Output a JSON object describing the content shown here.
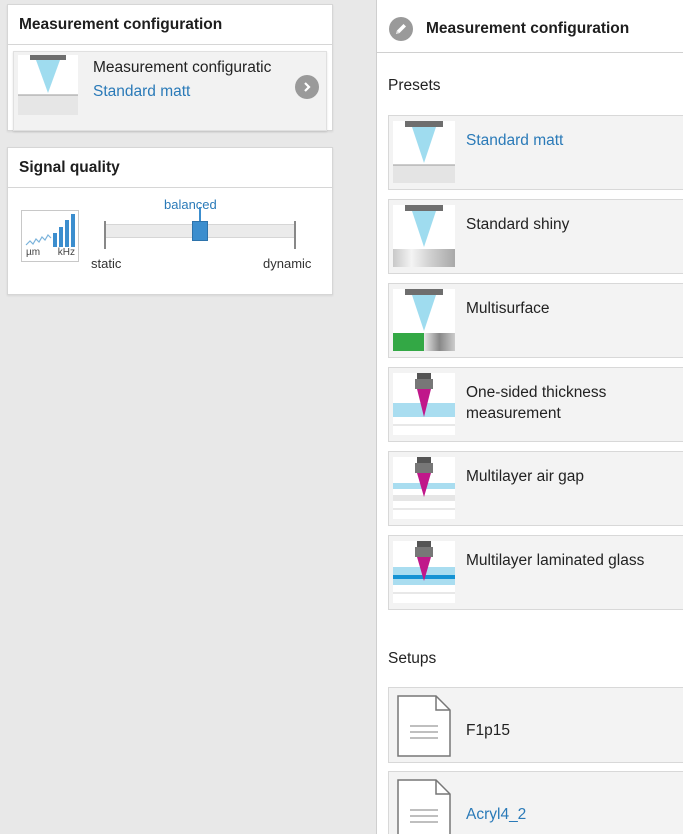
{
  "left": {
    "measurement_config": {
      "title": "Measurement configuration",
      "current_name": "Measurement configuratic",
      "current_preset": "Standard matt"
    },
    "signal_quality": {
      "title": "Signal quality",
      "icon_unit_left": "µm",
      "icon_unit_right": "kHz",
      "slider_value": "balanced",
      "slider_min_label": "static",
      "slider_max_label": "dynamic",
      "slider_level": 0.5
    }
  },
  "right": {
    "title": "Measurement configuration",
    "presets_label": "Presets",
    "presets": [
      {
        "name": "Standard matt",
        "icon": "standard-matt-icon",
        "selected": true
      },
      {
        "name": "Standard shiny",
        "icon": "standard-shiny-icon",
        "selected": false
      },
      {
        "name": "Multisurface",
        "icon": "multisurface-icon",
        "selected": false
      },
      {
        "name": "One-sided thickness measurement",
        "icon": "one-sided-thickness-icon",
        "selected": false
      },
      {
        "name": "Multilayer air gap",
        "icon": "multilayer-air-gap-icon",
        "selected": false
      },
      {
        "name": "Multilayer laminated glass",
        "icon": "multilayer-laminated-glass-icon",
        "selected": false
      }
    ],
    "setups_label": "Setups",
    "setups": [
      {
        "name": "F1p15",
        "icon": "document-icon",
        "selected": false
      },
      {
        "name": "Acryl4_2",
        "icon": "document-icon",
        "selected": true
      }
    ]
  },
  "colors": {
    "accent": "#2a7ab8",
    "slider": "#3c8ece",
    "laser_cyan": "#8fd8ee",
    "magenta": "#c0178a",
    "green": "#33a845"
  }
}
